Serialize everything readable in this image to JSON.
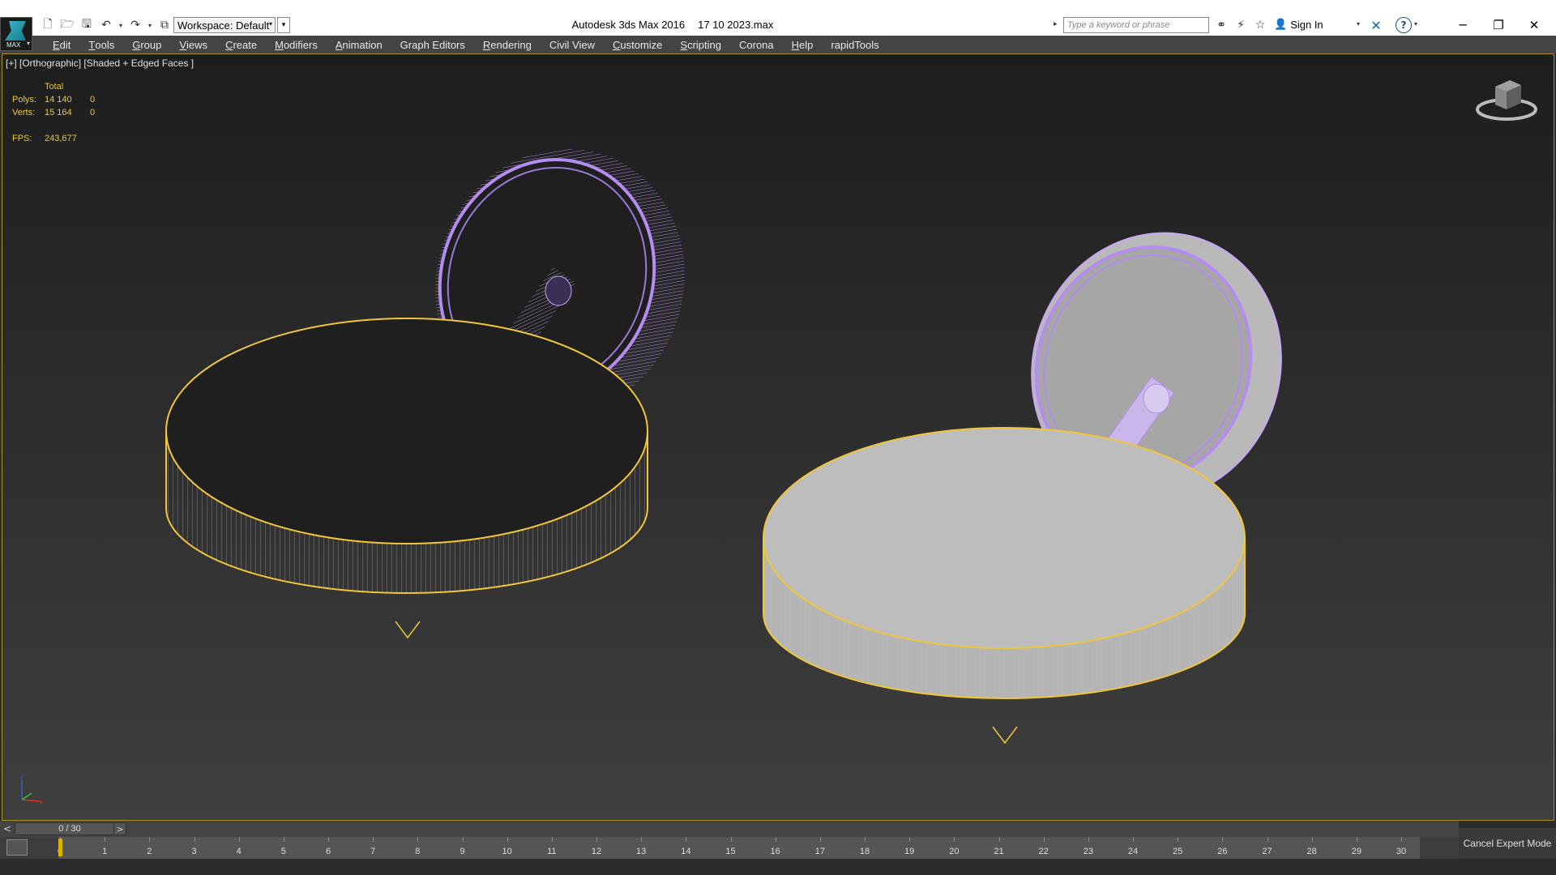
{
  "window": {
    "app_title": "Autodesk 3ds Max 2016",
    "file_name": "17 10 2023.max"
  },
  "app_logo": {
    "label": "MAX"
  },
  "quick_access": {
    "workspace_label": "Workspace: Default"
  },
  "search": {
    "placeholder": "Type a keyword or phrase"
  },
  "account": {
    "sign_in": "Sign In"
  },
  "menu": [
    {
      "label": "Edit",
      "ul": "E",
      "rest": "dit"
    },
    {
      "label": "Tools",
      "ul": "T",
      "rest": "ools"
    },
    {
      "label": "Group",
      "ul": "G",
      "rest": "roup"
    },
    {
      "label": "Views",
      "ul": "V",
      "rest": "iews"
    },
    {
      "label": "Create",
      "ul": "C",
      "rest": "reate"
    },
    {
      "label": "Modifiers",
      "ul": "M",
      "rest": "odifiers"
    },
    {
      "label": "Animation",
      "ul": "A",
      "rest": "nimation"
    },
    {
      "label": "Graph Editors",
      "ul": "",
      "rest": "Graph Editors"
    },
    {
      "label": "Rendering",
      "ul": "R",
      "rest": "endering"
    },
    {
      "label": "Civil View",
      "ul": "",
      "rest": "Civil View"
    },
    {
      "label": "Customize",
      "ul": "C",
      "rest": "ustomize"
    },
    {
      "label": "Scripting",
      "ul": "S",
      "rest": "cripting"
    },
    {
      "label": "Corona",
      "ul": "",
      "rest": "Corona"
    },
    {
      "label": "Help",
      "ul": "H",
      "rest": "elp"
    },
    {
      "label": "rapidTools",
      "ul": "",
      "rest": "rapidTools"
    }
  ],
  "viewport": {
    "label": "[+] [Orthographic] [Shaded + Edged Faces ]",
    "stats": {
      "header": "Total",
      "polys_label": "Polys:",
      "polys_total": "14 140",
      "polys_sel": "0",
      "verts_label": "Verts:",
      "verts_total": "15 164",
      "verts_sel": "0",
      "fps_label": "FPS:",
      "fps_value": "243,677"
    },
    "colors": {
      "selection": "#f0c63a",
      "wire_purple": "#b58cf0"
    }
  },
  "timeline": {
    "prev": "<",
    "next": ">",
    "current": "0 / 30",
    "ticks": [
      "0",
      "1",
      "2",
      "3",
      "4",
      "5",
      "6",
      "7",
      "8",
      "9",
      "10",
      "11",
      "12",
      "13",
      "14",
      "15",
      "16",
      "17",
      "18",
      "19",
      "20",
      "21",
      "22",
      "23",
      "24",
      "25",
      "26",
      "27",
      "28",
      "29",
      "30"
    ],
    "current_frame": 0
  },
  "status": {
    "cancel_expert": "Cancel Expert Mode"
  }
}
